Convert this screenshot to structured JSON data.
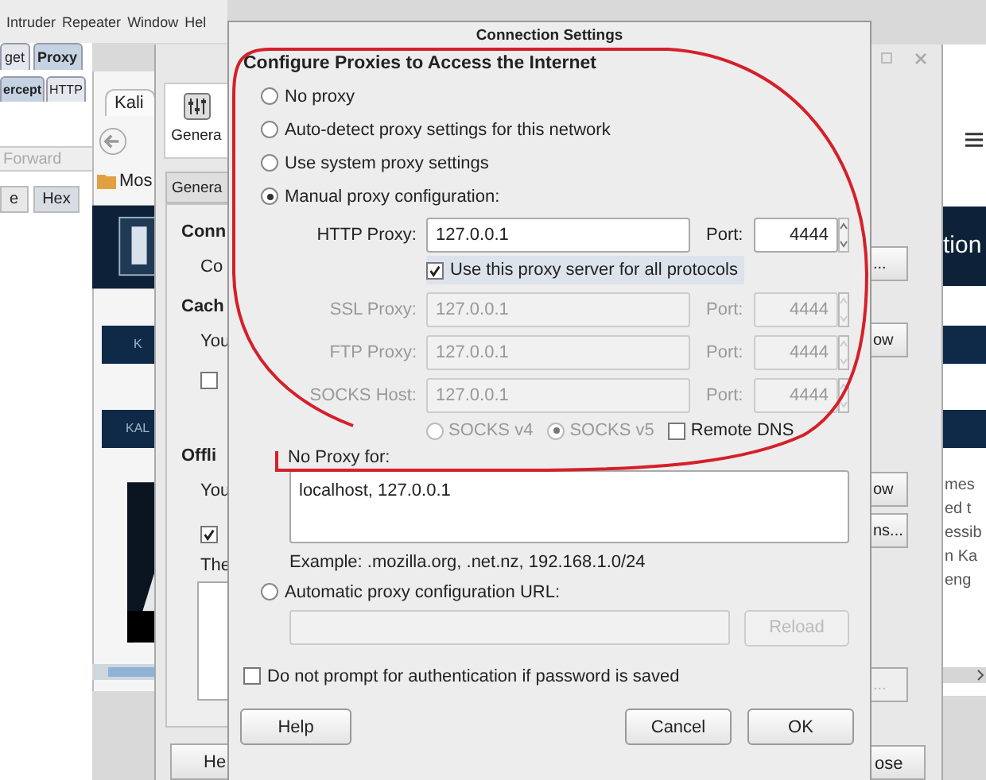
{
  "burp": {
    "menu": [
      "Intruder",
      "Repeater",
      "Window",
      "Hel"
    ],
    "tabs": [
      {
        "label": "get",
        "selected": false
      },
      {
        "label": "Proxy",
        "selected": true
      }
    ],
    "subtabs": [
      {
        "label": "ercept",
        "selected": true
      },
      {
        "label": "HTTP",
        "selected": false
      }
    ],
    "forward": "Forward",
    "view_tabs": [
      {
        "label": "e",
        "selected": false
      },
      {
        "label": "Hex",
        "selected": true
      }
    ]
  },
  "browser": {
    "tab": "Kali",
    "bookmark": "Mos",
    "banners": [
      "K",
      "KAL"
    ],
    "right_heading": "tion",
    "right_lines": [
      "mes",
      "ed t",
      "essib",
      "n Ka",
      "eng"
    ]
  },
  "preferences": {
    "toolbar_label": "Genera",
    "tab": "Genera",
    "left_items": [
      {
        "kind": "heading",
        "text": "Conn"
      },
      {
        "kind": "text",
        "text": "Co"
      },
      {
        "kind": "heading",
        "text": "Cach"
      },
      {
        "kind": "text",
        "text": "You"
      },
      {
        "kind": "checkbox",
        "checked": false
      },
      {
        "kind": "heading",
        "text": "Offli"
      },
      {
        "kind": "text",
        "text": "You"
      },
      {
        "kind": "checkbox",
        "checked": true
      },
      {
        "kind": "text",
        "text": "The"
      },
      {
        "kind": "textarea"
      }
    ],
    "right_buttons": [
      {
        "label": "...",
        "disabled": false
      },
      {
        "label": "ow",
        "disabled": false
      },
      {
        "label": "ow",
        "disabled": false
      },
      {
        "label": "ns...",
        "disabled": false
      },
      {
        "label": "...",
        "disabled": true
      }
    ],
    "help_button": "He",
    "close_button": "ose"
  },
  "dialog": {
    "title": "Connection Settings",
    "heading": "Configure Proxies to Access the Internet",
    "modes": [
      {
        "label": "No proxy",
        "selected": false
      },
      {
        "label": "Auto-detect proxy settings for this network",
        "selected": false
      },
      {
        "label": "Use system proxy settings",
        "selected": false
      },
      {
        "label": "Manual proxy configuration:",
        "selected": true
      }
    ],
    "proxies": [
      {
        "label": "HTTP Proxy:",
        "value": "127.0.0.1",
        "port_label": "Port:",
        "port": "4444",
        "disabled": false
      },
      {
        "label": "SSL Proxy:",
        "value": "127.0.0.1",
        "port_label": "Port:",
        "port": "4444",
        "disabled": true
      },
      {
        "label": "FTP Proxy:",
        "value": "127.0.0.1",
        "port_label": "Port:",
        "port": "4444",
        "disabled": true
      },
      {
        "label": "SOCKS Host:",
        "value": "127.0.0.1",
        "port_label": "Port:",
        "port": "4444",
        "disabled": true
      }
    ],
    "share": {
      "label": "Use this proxy server for all protocols",
      "checked": true
    },
    "socks": [
      {
        "label": "SOCKS v4",
        "selected": false
      },
      {
        "label": "SOCKS v5",
        "selected": true
      }
    ],
    "socks_disabled": true,
    "remote_dns": {
      "label": "Remote DNS",
      "checked": false
    },
    "no_proxy_label": "No Proxy for:",
    "no_proxy_value": "localhost, 127.0.0.1",
    "example": "Example: .mozilla.org, .net.nz, 192.168.1.0/24",
    "auto_url": {
      "label": "Automatic proxy configuration URL:",
      "selected": false,
      "reload": "Reload",
      "reload_disabled": true
    },
    "no_prompt": {
      "label": "Do not prompt for authentication if password is saved",
      "checked": false
    },
    "buttons": {
      "help": "Help",
      "cancel": "Cancel",
      "ok": "OK"
    }
  }
}
